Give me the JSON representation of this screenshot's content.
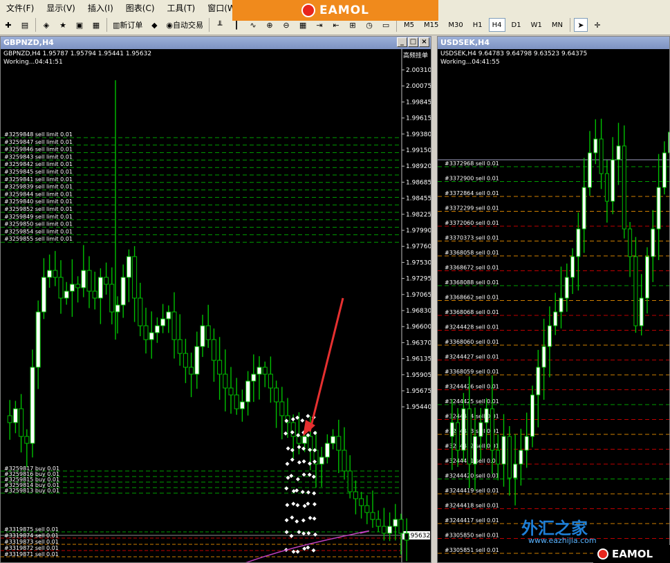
{
  "menu": [
    "文件(F)",
    "显示(V)",
    "插入(I)",
    "图表(C)",
    "工具(T)",
    "窗口(W)"
  ],
  "brand_text": "EAMOL",
  "toolbar": {
    "new_order": "新订单",
    "auto_trade": "自动交易",
    "timeframes": [
      "M5",
      "M15",
      "M30",
      "H1",
      "H4",
      "D1",
      "W1",
      "MN"
    ],
    "active_timeframe": "H4"
  },
  "left_chart": {
    "title": "GBPNZD,H4",
    "info_line": "GBPNZD,H4  1.95787 1.95794 1.95441 1.95632",
    "status": "Working...04:41:51",
    "expert_label": "高频挂单",
    "current_price": "1.95632",
    "price_axis": [
      "2.00310",
      "2.00075",
      "1.99845",
      "1.99615",
      "1.99380",
      "1.99150",
      "1.98920",
      "1.98685",
      "1.98455",
      "1.98225",
      "1.97990",
      "1.97760",
      "1.97530",
      "1.97295",
      "1.97065",
      "1.96830",
      "1.96600",
      "1.96370",
      "1.96135",
      "1.95905",
      "1.95675",
      "1.95440"
    ],
    "sell_orders": [
      "#3259848 sell limit 0.01",
      "#3259847 sell limit 0.01",
      "#3259846 sell limit 0.01",
      "#3259843 sell limit 0.01",
      "#3259842 sell limit 0.01",
      "#3259845 sell limit 0.01",
      "#3259841 sell limit 0.01",
      "#3259839 sell limit 0.01",
      "#3259844 sell limit 0.01",
      "#3259840 sell limit 0.01",
      "#3259852 sell limit 0.01",
      "#3259849 sell limit 0.01",
      "#3259850 sell limit 0.01",
      "#3259854 sell limit 0.01",
      "#3259855 sell limit 0.01"
    ],
    "buy_orders": [
      "#3259817 buy 0.01",
      "#3259816 buy 0.01",
      "#3259815 buy 0.01",
      "#3259814 buy 0.01",
      "#3259813 buy 0.01"
    ],
    "bottom_orders": [
      "#3319875 sell 0.01",
      "#3319874 sell 0.01",
      "#3319873 sell 0.01",
      "#3319872 sell 0.01",
      "#3319871 sell 0.01"
    ]
  },
  "right_chart": {
    "title": "USDSEK,H4",
    "info_line": "USDSEK,H4  9.64783 9.64798 9.63523 9.64375",
    "status": "Working...04:41:55",
    "orders": [
      "#3372968 sell 0.01",
      "#3372900 sell 0.01",
      "#3372864 sell 0.01",
      "#3372299 sell 0.01",
      "#3372060 sell 0.01",
      "#3370373 sell 0.01",
      "#3368058 sell 0.01",
      "#3368672 sell 0.01",
      "#3368088 sell 0.01",
      "#3368662 sell 0.01",
      "#3368068 sell 0.01",
      "#3244428 sell 0.01",
      "#3368060 sell 0.01",
      "#3244427 sell 0.01",
      "#3368059 sell 0.01",
      "#3244426 sell 0.01",
      "#3244425 sell 0.01",
      "#3244424 sell 0.01",
      "#3244423 sell 0.01",
      "#3244422 sell 0.01",
      "#3244421 sell 0.01",
      "#3244420 sell 0.01",
      "#3244419 sell 0.01",
      "#3244418 sell 0.01",
      "#3244417 sell 0.01",
      "#3305850 sell 0.01",
      "#3305851 sell 0.01"
    ]
  },
  "watermark": {
    "text": "外汇之家",
    "url": "www.eazhijia.com"
  },
  "colors": {
    "bull": "#ffffff",
    "bear": "#00c000",
    "sell_line": "#00a000",
    "buy_line": "#00a000",
    "orange_line": "#d08000",
    "red_line": "#c00000",
    "arrow": "#e63030"
  }
}
